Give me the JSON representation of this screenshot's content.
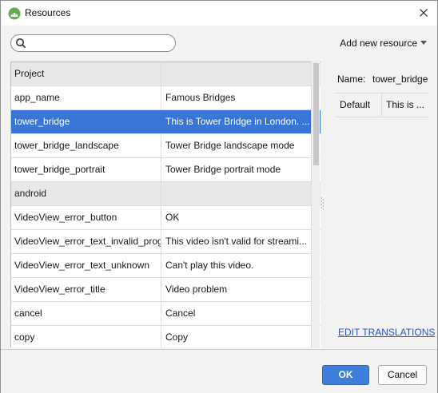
{
  "window": {
    "title": "Resources"
  },
  "toolbar": {
    "search_placeholder": "",
    "search_value": "",
    "add_resource_label": "Add new resource"
  },
  "resources": {
    "rows": [
      {
        "type": "group",
        "name": "Project",
        "value": ""
      },
      {
        "type": "item",
        "name": "app_name",
        "value": "Famous Bridges"
      },
      {
        "type": "item",
        "name": "tower_bridge",
        "value": "This is Tower Bridge in London. ...",
        "selected": true
      },
      {
        "type": "item",
        "name": "tower_bridge_landscape",
        "value": "Tower Bridge landscape mode"
      },
      {
        "type": "item",
        "name": "tower_bridge_portrait",
        "value": "Tower Bridge portrait mode"
      },
      {
        "type": "group",
        "name": "android",
        "value": ""
      },
      {
        "type": "item",
        "name": "VideoView_error_button",
        "value": "OK"
      },
      {
        "type": "item",
        "name": "VideoView_error_text_invalid_progr",
        "value": "This video isn't valid for streami..."
      },
      {
        "type": "item",
        "name": "VideoView_error_text_unknown",
        "value": "Can't play this video."
      },
      {
        "type": "item",
        "name": "VideoView_error_title",
        "value": "Video problem"
      },
      {
        "type": "item",
        "name": "cancel",
        "value": "Cancel"
      },
      {
        "type": "item",
        "name": "copy",
        "value": "Copy"
      }
    ]
  },
  "detail": {
    "name_label": "Name:",
    "name_value": "tower_bridge",
    "columns": [
      "Default",
      "This is ..."
    ],
    "edit_link": "EDIT TRANSLATIONS"
  },
  "buttons": {
    "ok": "OK",
    "cancel": "Cancel"
  },
  "colors": {
    "selection": "#3875d7",
    "primary_button": "#3d7fdb",
    "link": "#2a54c8",
    "app_icon": "#8bc34a"
  },
  "icons": {
    "app": "android-studio-icon",
    "close": "close-icon",
    "search": "search-icon",
    "dropdown": "chevron-down-icon"
  }
}
